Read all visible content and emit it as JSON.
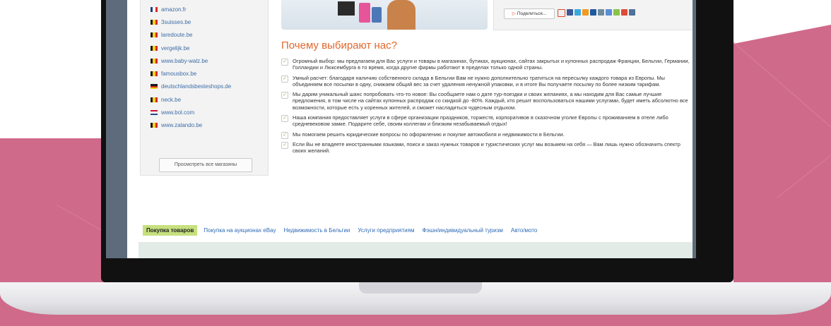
{
  "colors": {
    "background_pink": "#cf6a8a",
    "accent_orange": "#e2672c",
    "link_blue": "#3d6ea8",
    "active_tab_green": "#c6e07e"
  },
  "sidebar": {
    "stores": [
      {
        "label": "amazon.fr",
        "flag": "france"
      },
      {
        "label": "3suisses.be",
        "flag": "belgium"
      },
      {
        "label": "laredoute.be",
        "flag": "belgium"
      },
      {
        "label": "vergelijk.be",
        "flag": "belgium"
      },
      {
        "label": "www.baby-walz.be",
        "flag": "belgium"
      },
      {
        "label": "famousbox.be",
        "flag": "belgium"
      },
      {
        "label": "deutschlandsbesteshops.de",
        "flag": "germany"
      },
      {
        "label": "neck.be",
        "flag": "belgium"
      },
      {
        "label": "www.bol.com",
        "flag": "netherlands"
      },
      {
        "label": "www.zalando.be",
        "flag": "belgium"
      }
    ],
    "all_stores_button": "Просмотреть все магазины"
  },
  "share": {
    "button_label": "Поделиться...",
    "icons": [
      "livejournal-icon",
      "facebook-icon",
      "twitter-icon",
      "odnoklassniki-icon",
      "mailru-icon",
      "pen-icon",
      "myworld-icon",
      "bookmark-icon",
      "google-icon",
      "vkontakte-icon"
    ]
  },
  "why": {
    "title": "Почему выбирают нас?",
    "reasons": [
      "Огромный выбор: мы предлагаем для Вас услуги и товары в магазинах, бутиках, аукционах, сайтах закрытых и купонных распродаж Франции, Бельгии, Германии, Голландии и Люксембурга в то время, когда другие фирмы работают в пределах только одной страны.",
      "Умный расчет: благодаря наличию собственного склада в Бельгии Вам не нужно дополнительно тратиться на пересылку каждого товара из Европы. Мы объединяем все посылки в одну, снижаем общий вес за счет удаления ненужной упаковки, и в итоге Вы получаете посылку по более низким тарифам.",
      "Мы дарим уникальный шанс попробовать что-то новое: Вы сообщаете нам о дате тур-поездки и своих желаниях, а мы находим для Вас самые лучшие предложения, в том числе на сайтах купонных распродаж со скидкой до -80%. Каждый, кто решит воспользоваться нашими услугами, будет иметь абсолютно все возможности, которые есть у коренных жителей, и сможет насладиться чудесным отдыхом.",
      "Наша компания предоставляет услуги в сфере организации праздников, торжеств, корпоративов в сказочном уголке Европы с проживанием в отеле либо средневековом замке. Подарите себе, своим коллегам и близким незабываемый отдых!",
      "Мы помогаем решить юридические вопросы по оформлению и покупке автомобиля и недвижимости в Бельгии.",
      "Если Вы не владеете иностранными языками, поиск и заказ нужных товаров и туристических услуг мы возьмем на себя — Вам лишь нужно обозначить спектр своих желаний."
    ]
  },
  "tabs": [
    {
      "label": "Покупка товаров",
      "active": true
    },
    {
      "label": "Покупка на аукционах eBay",
      "active": false
    },
    {
      "label": "Недвижимость в Бельгии",
      "active": false
    },
    {
      "label": "Услуги предприятиям",
      "active": false
    },
    {
      "label": "Фэшн/индивидуальный туризм",
      "active": false
    },
    {
      "label": "Авто/мото",
      "active": false
    }
  ]
}
